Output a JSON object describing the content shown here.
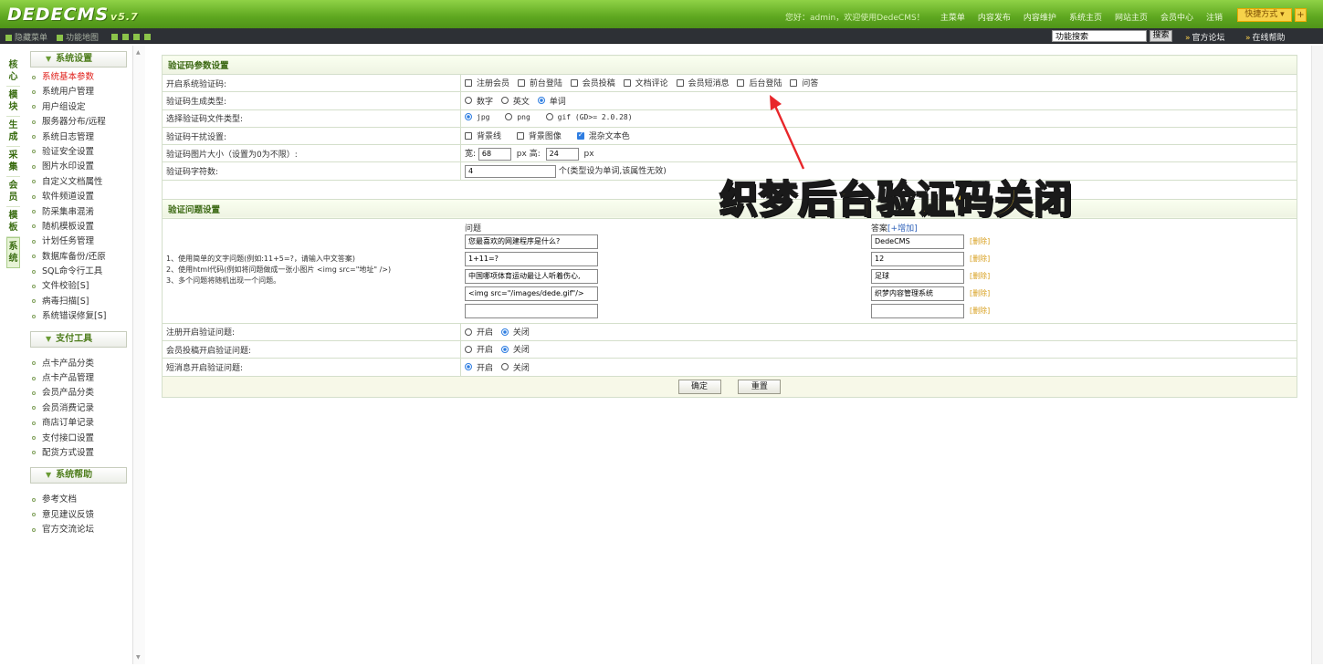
{
  "header": {
    "logo": "DEDECMS",
    "version": "v5.7",
    "welcome": "您好：admin，欢迎使用DedeCMS！",
    "nav": [
      "主菜单",
      "内容发布",
      "内容维护",
      "系统主页",
      "网站主页",
      "会员中心",
      "注销"
    ],
    "quick": "快捷方式",
    "quick_add": "+"
  },
  "toolbar": {
    "hide_menu": "隐藏菜单",
    "site_map": "功能地图",
    "search_value": "功能搜索",
    "search_button": "搜索",
    "forum": "官方论坛",
    "help": "在线帮助"
  },
  "vtabs": [
    "核心",
    "模块",
    "生成",
    "采集",
    "会员",
    "模板",
    "系统"
  ],
  "sidebar": {
    "groups": [
      {
        "title": "系统设置",
        "items": [
          "系统基本参数",
          "系统用户管理",
          "用户组设定",
          "服务器分布/远程",
          "系统日志管理",
          "验证安全设置",
          "图片水印设置",
          "自定义文档属性",
          "软件频道设置",
          "防采集串混淆",
          "随机模板设置",
          "计划任务管理",
          "数据库备份/还原",
          "SQL命令行工具",
          "文件校验[S]",
          "病毒扫描[S]",
          "系统错误修复[S]"
        ]
      },
      {
        "title": "支付工具",
        "items": [
          "点卡产品分类",
          "点卡产品管理",
          "会员产品分类",
          "会员消费记录",
          "商店订单记录",
          "支付接口设置",
          "配货方式设置"
        ]
      },
      {
        "title": "系统帮助",
        "items": [
          "参考文档",
          "意见建议反馈",
          "官方交流论坛"
        ]
      }
    ]
  },
  "captcha": {
    "section_title": "验证码参数设置",
    "enable_label": "开启系统验证码:",
    "enable_options": [
      {
        "label": "注册会员",
        "checked": false
      },
      {
        "label": "前台登陆",
        "checked": false
      },
      {
        "label": "会员投稿",
        "checked": false
      },
      {
        "label": "文档评论",
        "checked": false
      },
      {
        "label": "会员短消息",
        "checked": false
      },
      {
        "label": "后台登陆",
        "checked": false
      },
      {
        "label": "问答",
        "checked": false
      }
    ],
    "gen_type_label": "验证码生成类型:",
    "gen_type_options": [
      {
        "label": "数字",
        "checked": false
      },
      {
        "label": "英文",
        "checked": false
      },
      {
        "label": "单词",
        "checked": true
      }
    ],
    "file_type_label": "选择验证码文件类型:",
    "file_type_options": [
      {
        "label": "jpg",
        "checked": true
      },
      {
        "label": "png",
        "checked": false
      },
      {
        "label": "gif (GD>= 2.0.28)",
        "checked": false
      }
    ],
    "noise_label": "验证码干扰设置:",
    "noise_options": [
      {
        "label": "背景线",
        "checked": false
      },
      {
        "label": "背景图像",
        "checked": false
      },
      {
        "label": "混杂文本色",
        "checked": true
      }
    ],
    "size_label": "验证码图片大小（设置为0为不限）:",
    "width_label": "宽:",
    "width_value": "68",
    "px_height_label": "px 高:",
    "height_value": "24",
    "px_label": "px",
    "length_label": "验证码字符数:",
    "length_value": "4",
    "length_note": "个(类型设为单词,该属性无效)"
  },
  "question": {
    "section_title": "验证问题设置",
    "notes": [
      "1、使用简单的文字问题(例如:11+5=?，请输入中文答案)",
      "2、使用html代码(例如将问题做成一张小图片 <img src=\"地址\" />)",
      "3、多个问题将随机出现一个问题。"
    ],
    "question_head": "问题",
    "answer_head": "答案",
    "answer_add": "[+增加]",
    "questions": [
      "您最喜欢的网建程序是什么?",
      "1+11=?",
      "中国哪项体育运动最让人听着伤心,",
      "<img src=\"/images/dede.gif\"/>",
      ""
    ],
    "answers": [
      "DedeCMS",
      "12",
      "足球",
      "织梦内容管理系统",
      ""
    ],
    "delete_label": "[删除]",
    "register_label": "注册开启验证问题:",
    "register_options": [
      {
        "label": "开启",
        "checked": false
      },
      {
        "label": "关闭",
        "checked": true
      }
    ],
    "submit_label": "会员投稿开启验证问题:",
    "submit_options": [
      {
        "label": "开启",
        "checked": false
      },
      {
        "label": "关闭",
        "checked": true
      }
    ],
    "message_label": "短消息开启验证问题:",
    "message_options": [
      {
        "label": "开启",
        "checked": true
      },
      {
        "label": "关闭",
        "checked": false
      }
    ]
  },
  "buttons": {
    "ok": "确定",
    "reset": "重置"
  },
  "annotation": {
    "text": "织梦后台验证码关闭",
    "color": "#ffd13a",
    "arrow_color": "#e8262a"
  }
}
